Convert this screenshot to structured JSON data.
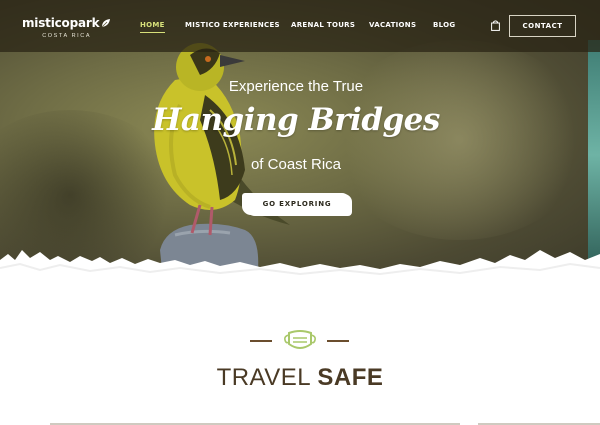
{
  "header": {
    "logo_name": "misticopark",
    "logo_sub": "COSTA RICA",
    "nav": [
      {
        "label": "HOME",
        "active": true
      },
      {
        "label": "MISTICO EXPERIENCES",
        "active": false
      },
      {
        "label": "ARENAL TOURS",
        "active": false
      },
      {
        "label": "VACATIONS",
        "active": false
      },
      {
        "label": "BLOG",
        "active": false
      }
    ],
    "cart_icon": "shopping-bag-icon",
    "contact_label": "CONTACT"
  },
  "hero": {
    "line1": "Experience the True",
    "headline": "Hanging Bridges",
    "line3": "of Coast Rica",
    "cta_label": "GO EXPLORING"
  },
  "section": {
    "icon": "face-mask-icon",
    "title_light": "TRAVEL ",
    "title_bold": "SAFE"
  },
  "colors": {
    "nav_active": "#d7e07a",
    "brown_accent": "#6b4e2e",
    "title_text": "#4a3a25",
    "mask_green": "#a9c86a"
  }
}
